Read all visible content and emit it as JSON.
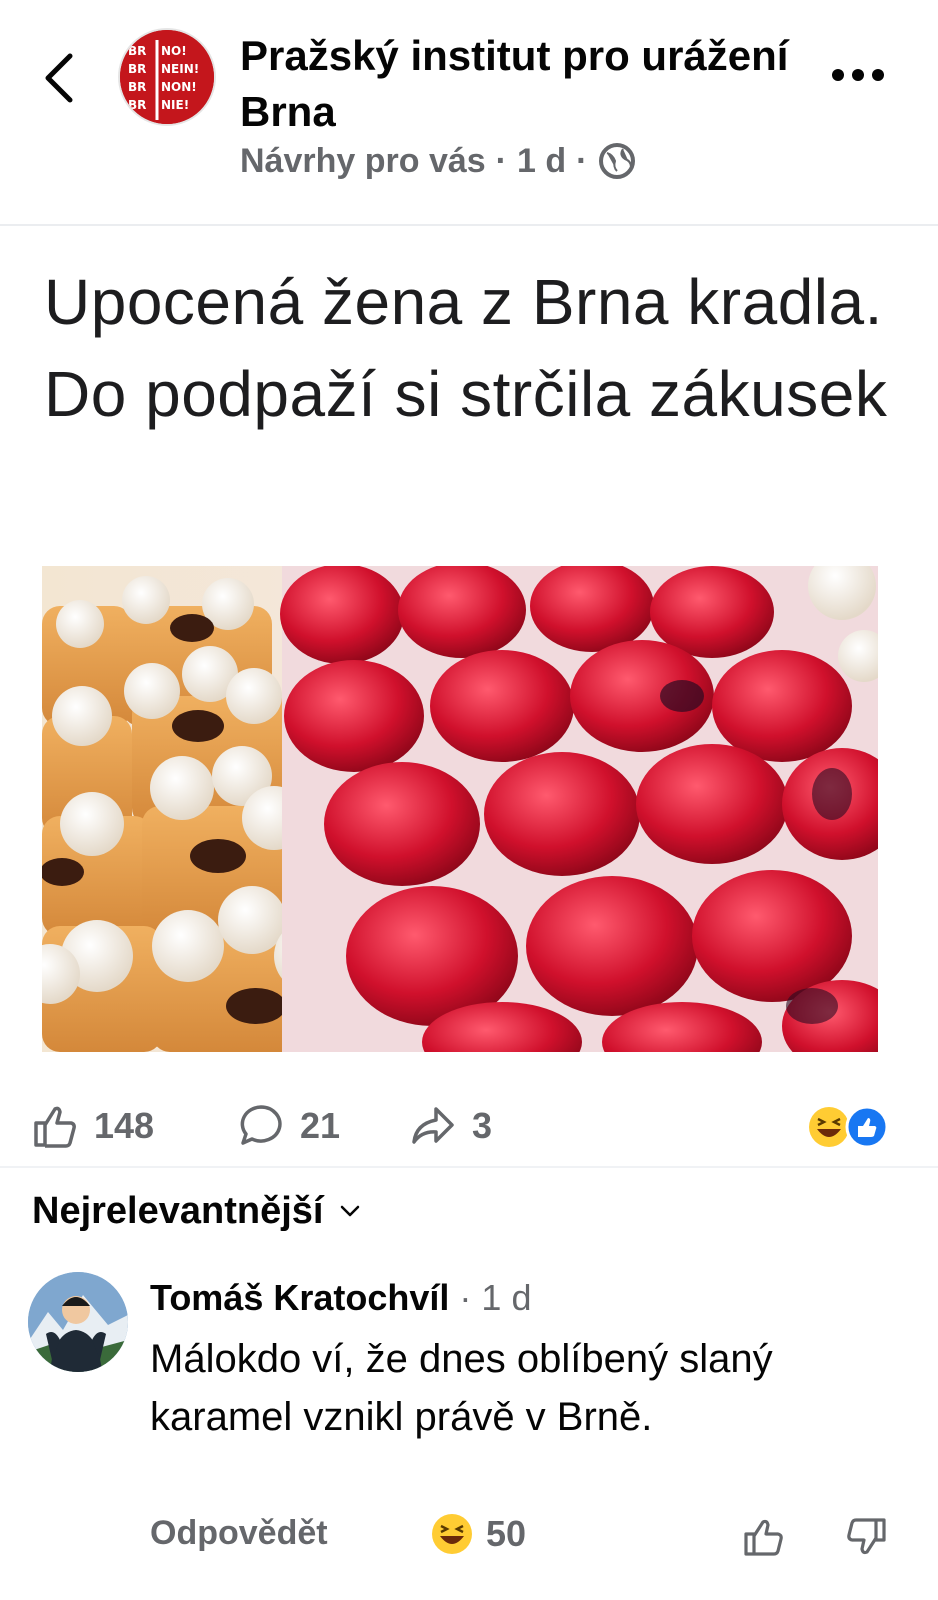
{
  "header": {
    "page_name": "Pražský institut pro urážení Brna",
    "meta_text": "Návrhy pro vás",
    "time": "1 d",
    "separator": "·",
    "avatar_logo_lines": [
      "BR NO!",
      "BR NEIN!",
      "BR NON!",
      "BR NIE!"
    ],
    "icons": {
      "back": "chevron-left-icon",
      "more": "more-dots-icon",
      "audience": "globe-icon"
    }
  },
  "post": {
    "headline": "Upocená žena z Brna kradla. Do podpaží si strčila zákusek",
    "image_alt_subject": "pastries-photo"
  },
  "stats": {
    "likes": "148",
    "comments": "21",
    "shares": "3",
    "reaction_icons": [
      "laughing-emoji-icon",
      "like-reaction-icon"
    ]
  },
  "comments_sort": {
    "label": "Nejrelevantnější",
    "icon": "chevron-down-icon"
  },
  "comment": {
    "author": "Tomáš Kratochvíl",
    "separator": "·",
    "time": "1 d",
    "text": "Málokdo ví, že dnes oblíbený slaný karamel vznikl právě v Brně.",
    "reply_label": "Odpovědět",
    "reaction_count": "50",
    "reaction_icon": "laughing-emoji-icon"
  },
  "colors": {
    "text_primary": "#050505",
    "text_secondary": "#65676b",
    "facebook_blue": "#1877f2",
    "logo_red": "#c4161c"
  }
}
